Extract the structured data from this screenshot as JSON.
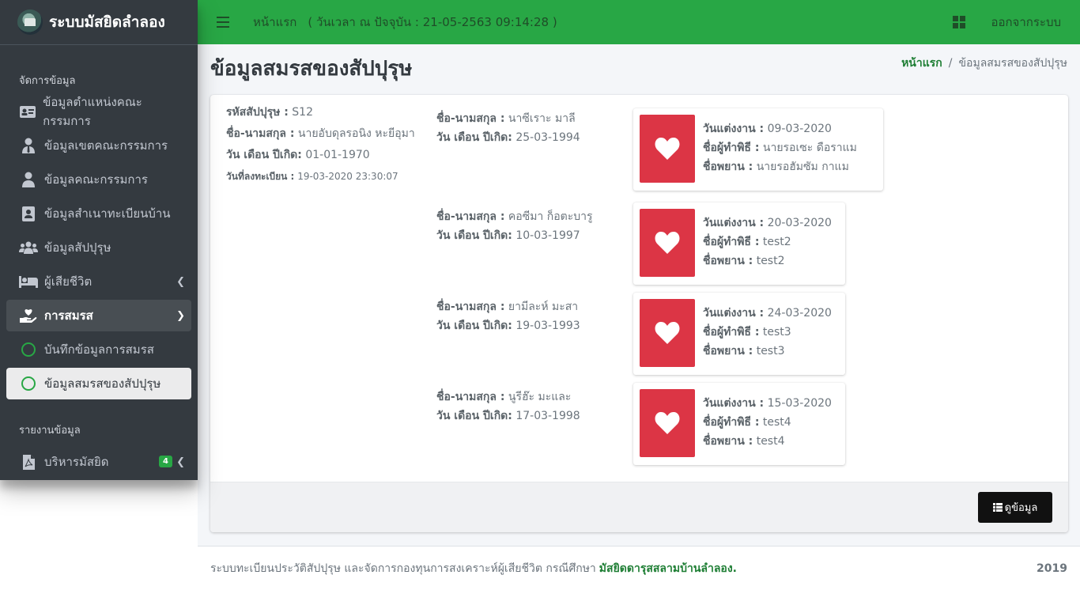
{
  "sidebar": {
    "brand": "ระบบมัสยิดลำลอง",
    "section_manage": "จัดการข้อมูล",
    "items": [
      {
        "label": "ข้อมูลตำแหน่งคณะกรรมการ",
        "icon": "id-card-icon"
      },
      {
        "label": "ข้อมูลเขตคณะกรรมการ",
        "icon": "user-tie-icon"
      },
      {
        "label": "ข้อมูลคณะกรรมการ",
        "icon": "user-icon"
      },
      {
        "label": "ข้อมูลสำเนาทะเบียนบ้าน",
        "icon": "address-card-icon"
      },
      {
        "label": "ข้อมูลสัปปุรุษ",
        "icon": "users-icon"
      },
      {
        "label": "ผู้เสียชีวิต",
        "icon": "bed-icon"
      },
      {
        "label": "การสมรส",
        "icon": "hand-holding-heart-icon"
      },
      {
        "label": "บันทึกข้อมูลการสมรส",
        "icon": "circle-icon"
      },
      {
        "label": "ข้อมูลสมรสของสัปปุรุษ",
        "icon": "circle-icon"
      }
    ],
    "section_report": "รายงานข้อมูล",
    "report_item": {
      "label": "บริหารมัสยิด",
      "badge": "4",
      "icon": "file-pdf-icon"
    }
  },
  "topbar": {
    "home": "หน้าแรก",
    "time": "( วันเวลา ณ ปัจจุบัน : 21-05-2563 09:14:28 )",
    "logout": "ออกจากระบบ"
  },
  "page": {
    "title": "ข้อมูลสมรสของสัปปุรุษ",
    "breadcrumb_home": "หน้าแรก",
    "breadcrumb_sep": "/",
    "breadcrumb_current": "ข้อมูลสมรสของสัปปุรุษ"
  },
  "owner": {
    "id_label": "รหัสสัปปุรุษ :",
    "id_value": "S12",
    "name_label": "ชื่อ-นามสกุล :",
    "name_value": "นายอับดุลรอนิง หะยีอุมา",
    "dob_label": "วัน เดือน ปีเกิด:",
    "dob_value": "01-01-1970",
    "reg_label": "วันที่ลงทะเบียน :",
    "reg_value": "19-03-2020 23:30:07"
  },
  "labels": {
    "spouse_name": "ชื่อ-นามสกุล :",
    "spouse_dob": "วัน เดือน ปีเกิด:",
    "wedding_date": "วันแต่งงาน :",
    "officiant": "ชื่อผู้ทำพิธี :",
    "witness": "ชื่อพยาน :"
  },
  "spouses": [
    {
      "name": "นาซีเราะ มาลี",
      "dob": "25-03-1994",
      "wedding": "09-03-2020",
      "officiant": "นายรอเซะ ดือราแม",
      "witness": "นายรอฮัมซัม กาแม"
    },
    {
      "name": "คอซีมา ก็อตะบารู",
      "dob": "10-03-1997",
      "wedding": "20-03-2020",
      "officiant": "test2",
      "witness": "test2"
    },
    {
      "name": "ยามีละห์ มะสา",
      "dob": "19-03-1993",
      "wedding": "24-03-2020",
      "officiant": "test3",
      "witness": "test3"
    },
    {
      "name": "นูรีฮ๊ะ มะและ",
      "dob": "17-03-1998",
      "wedding": "15-03-2020",
      "officiant": "test4",
      "witness": "test4"
    }
  ],
  "button_view": "ดูข้อมูล",
  "footer": {
    "text": "ระบบทะเบียนประวัติสัปปุรุษ และจัดการกองทุนการสงเคราะห์ผู้เสียชีวิต กรณีศึกษา",
    "school": "มัสยิดดารุสสลามบ้านลำลอง.",
    "year": "2019"
  },
  "colors": {
    "accent": "#28a745",
    "heart": "#dc3545",
    "sidebar": "#343a40"
  }
}
